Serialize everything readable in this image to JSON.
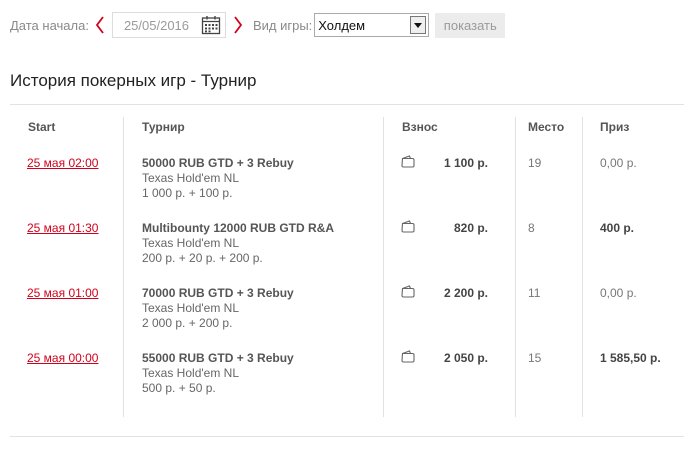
{
  "filters": {
    "start_date_label": "Дата начала:",
    "start_date_value": "25/05/2016",
    "game_type_label": "Вид игры:",
    "game_type_value": "Холдем",
    "show_button_label": "показать"
  },
  "page_title": "История покерных игр - Турнир",
  "table": {
    "headers": {
      "start": "Start",
      "tournament": "Турнир",
      "fee": "Взнос",
      "place": "Место",
      "prize": "Приз"
    },
    "rows": [
      {
        "date": "25 мая 02:00",
        "name": "50000 RUB GTD + 3 Rebuy",
        "game": "Texas Hold'em NL",
        "breakdown": "1 000 р. + 100 р.",
        "fee": "1 100 р.",
        "place": "19",
        "prize": "0,00 р."
      },
      {
        "date": "25 мая 01:30",
        "name": "Multibounty 12000 RUB GTD R&A",
        "game": "Texas Hold'em NL",
        "breakdown": "200 р. + 20 р. + 200 р.",
        "fee": "820 р.",
        "place": "8",
        "prize": "400 р."
      },
      {
        "date": "25 мая 01:00",
        "name": "70000 RUB GTD + 3 Rebuy",
        "game": "Texas Hold'em NL",
        "breakdown": "2 000 р. + 200 р.",
        "fee": "2 200 р.",
        "place": "11",
        "prize": "0,00 р."
      },
      {
        "date": "25 мая 00:00",
        "name": "55000 RUB GTD + 3 Rebuy",
        "game": "Texas Hold'em NL",
        "breakdown": "500 р. + 50 р.",
        "fee": "2 050 р.",
        "place": "15",
        "prize": "1 585,50 р."
      }
    ]
  },
  "colors": {
    "accent": "#d0021b",
    "divider": "#e2e2e2"
  },
  "icons": {
    "prev": "chevron-left-icon",
    "next": "chevron-right-icon",
    "calendar": "calendar-icon",
    "dropdown": "dropdown-arrow-icon",
    "fee": "wallet-icon"
  }
}
